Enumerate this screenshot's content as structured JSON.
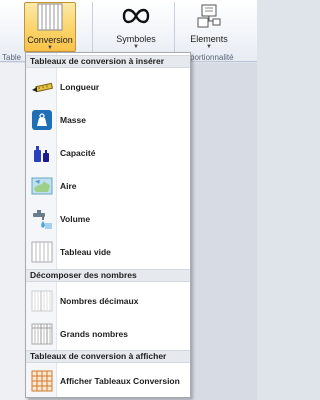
{
  "ribbon": {
    "conversion_label": "Conversion",
    "symboles_label": "Symboles",
    "elements_label": "Elements",
    "group_left_partial": "Table",
    "group_right_partial": "portionnalité",
    "accent": "#fbd46a"
  },
  "menu": {
    "sections": [
      "Tableaux de conversion à insérer",
      "Décomposer des nombres",
      "Tableaux de conversion à afficher"
    ],
    "items": [
      {
        "label": "Longueur",
        "icon": "ruler-icon"
      },
      {
        "label": "Masse",
        "icon": "weight-icon"
      },
      {
        "label": "Capacité",
        "icon": "bottles-icon"
      },
      {
        "label": "Aire",
        "icon": "map-area-icon"
      },
      {
        "label": "Volume",
        "icon": "faucet-icon"
      },
      {
        "label": "Tableau vide",
        "icon": "empty-table-icon"
      },
      {
        "label": "Nombres décimaux",
        "icon": "decimal-table-icon"
      },
      {
        "label": "Grands nombres",
        "icon": "big-numbers-table-icon"
      },
      {
        "label": "Afficher Tableaux Conversion",
        "icon": "grid-table-icon"
      }
    ]
  }
}
